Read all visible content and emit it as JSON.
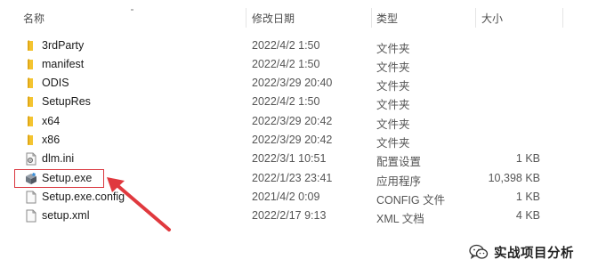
{
  "columns": {
    "name": "名称",
    "date": "修改日期",
    "type": "类型",
    "size": "大小"
  },
  "files": [
    {
      "name": "3rdParty",
      "date": "2022/4/2 1:50",
      "type": "文件夹",
      "size": "",
      "icon": "folder-icon"
    },
    {
      "name": "manifest",
      "date": "2022/4/2 1:50",
      "type": "文件夹",
      "size": "",
      "icon": "folder-icon"
    },
    {
      "name": "ODIS",
      "date": "2022/3/29 20:40",
      "type": "文件夹",
      "size": "",
      "icon": "folder-icon"
    },
    {
      "name": "SetupRes",
      "date": "2022/4/2 1:50",
      "type": "文件夹",
      "size": "",
      "icon": "folder-icon"
    },
    {
      "name": "x64",
      "date": "2022/3/29 20:42",
      "type": "文件夹",
      "size": "",
      "icon": "folder-icon"
    },
    {
      "name": "x86",
      "date": "2022/3/29 20:42",
      "type": "文件夹",
      "size": "",
      "icon": "folder-icon"
    },
    {
      "name": "dlm.ini",
      "date": "2022/3/1 10:51",
      "type": "配置设置",
      "size": "1 KB",
      "icon": "ini-file-icon"
    },
    {
      "name": "Setup.exe",
      "date": "2022/1/23 23:41",
      "type": "应用程序",
      "size": "10,398 KB",
      "icon": "setup-exe-icon"
    },
    {
      "name": "Setup.exe.config",
      "date": "2021/4/2 0:09",
      "type": "CONFIG 文件",
      "size": "1 KB",
      "icon": "file-icon"
    },
    {
      "name": "setup.xml",
      "date": "2022/2/17 9:13",
      "type": "XML 文档",
      "size": "4 KB",
      "icon": "file-icon"
    }
  ],
  "annotation": {
    "highlight_color": "#d9363e",
    "target": "Setup.exe"
  },
  "watermark": {
    "text": "实战项目分析",
    "icon": "wechat-icon"
  },
  "colors": {
    "folder": "#f4c430",
    "arrow": "#e0393e"
  }
}
